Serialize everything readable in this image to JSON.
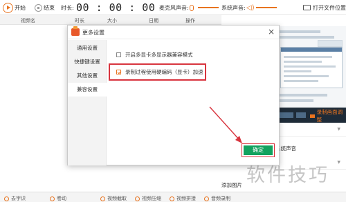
{
  "toolbar": {
    "start_label": "开始",
    "stop_label": "结束",
    "duration_label": "时长:",
    "timer": "00 : 00 : 00",
    "mic_label": "麦克风声音:",
    "system_sound_label": "系统声音:",
    "open_folder_label": "打开文件位置"
  },
  "file_list": {
    "columns": [
      "视频名",
      "时长",
      "大小",
      "日期",
      "操作"
    ]
  },
  "right_panel": {
    "camera_label": "录制画面调整",
    "system_sound_option": "系统声音",
    "add_image_label": "添加图片"
  },
  "bottom_bar": {
    "items": [
      "去字识",
      "卷动",
      "视频截取",
      "视频压缩",
      "视频拼接",
      "音频录制"
    ]
  },
  "dialog": {
    "title": "更多设置",
    "close_glyph": "×",
    "sidebar": [
      "通用设置",
      "快捷键设置",
      "其他设置",
      "兼容设置"
    ],
    "active_tab": "兼容设置",
    "options": [
      {
        "label": "开启多显卡多显示器兼容模式",
        "checked": false
      },
      {
        "label": "录制过程使用硬编码（显卡）加速",
        "checked": true
      }
    ],
    "confirm_label": "确定"
  },
  "watermark": "软件技巧",
  "colors": {
    "accent": "#e8731f",
    "confirm_bg": "#12a25e",
    "highlight_red": "#d8343e"
  },
  "icons": [
    "record-start-icon",
    "record-stop-icon",
    "microphone-icon",
    "speaker-icon",
    "folder-icon",
    "app-logo-icon",
    "close-icon",
    "checkbox-icon",
    "camera-icon"
  ]
}
